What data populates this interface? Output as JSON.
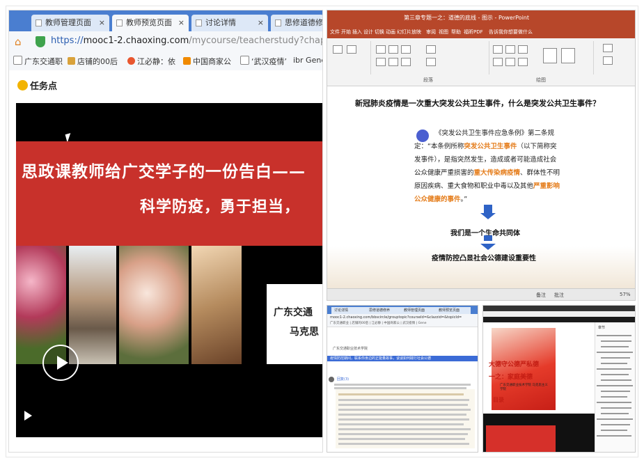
{
  "left_browser": {
    "tabs": [
      {
        "label": "教师管理页面",
        "close": "×"
      },
      {
        "label": "教师预览页面",
        "close": "×"
      },
      {
        "label": "讨论详情",
        "close": "×"
      },
      {
        "label": "思修道德修",
        "close": ""
      }
    ],
    "url_https": "https://",
    "url_host": "mooc1-2.chaoxing.com",
    "url_path": "/mycourse/teacherstudy?chapterId=",
    "bookmarks": [
      "广东交通职",
      "店铺的00后",
      "江必静：依",
      "中国商家公",
      "‘武汉疫情’",
      "ibr Gene"
    ],
    "task_label": "任务点",
    "video_title_line1": "思政课教师给广交学子的一份告白——",
    "video_title_line2": "科学防疫，勇于担当，",
    "video_org_line1": "广东交通",
    "video_org_line2": "马克思"
  },
  "ppt": {
    "window_title": "第三章专题一之：道德的底线 - 图示 - PowerPoint",
    "ribbon_tabs": [
      "文件",
      "开始",
      "插入",
      "设计",
      "切换",
      "动画",
      "幻灯片放映",
      "审阅",
      "视图",
      "帮助",
      "福昕PDF",
      "告诉我你想要做什么"
    ],
    "ribbon_groups": [
      "段落",
      "绘图"
    ],
    "question": "新冠肺炎疫情是一次重大突发公共卫生事件，什么是突发公共卫生事件？",
    "body_parts": [
      {
        "text": "《突发公共卫生事件应急条例》第二条规定：“本条例所称",
        "hl": false
      },
      {
        "text": "突发公共卫生事件",
        "hl": true
      },
      {
        "text": "（以下简称突发事件），是指突然发生，造成或者可能造成社会公众健康严重损害的",
        "hl": false
      },
      {
        "text": "重大传染病疫情",
        "hl": true
      },
      {
        "text": "、群体性不明原因疾病、重大食物和职业中毒以及其他",
        "hl": false
      },
      {
        "text": "严重影响公众健康的事件",
        "hl": true
      },
      {
        "text": "。”",
        "hl": false
      }
    ],
    "statement1": "我们是一个生命共同体",
    "statement2": "疫情防控凸显社会公德建设重要性",
    "status_notes": "备注",
    "status_comments": "批注",
    "status_zoom": "57%"
  },
  "mid_browser": {
    "tabs": [
      "讨论详情",
      "思修道德修养",
      "教师管理页面",
      "教师预览页面"
    ],
    "url": "mooc1-2.chaoxing.com/bbscircle/grouptopic?courseId=&clazzid=&topicId=",
    "bookmarks": "广东交通职业 | 店铺的00后 | 江必静 | 中国商家公 | 武汉疫情 | Gene",
    "breadcrumb": "广东交通职业技术学院",
    "banner": "疫情防控期间，联系你身边的正能量故事，谈谈如何践行社会公德",
    "reply_title": "回复(3)"
  },
  "course": {
    "header_line1": "大德守公德严私德",
    "header_line2": "一之：家庭美德",
    "subtitle": "广东交通职业技术学院 马克思主义学院",
    "toc": "目录",
    "side_title": "章节"
  }
}
